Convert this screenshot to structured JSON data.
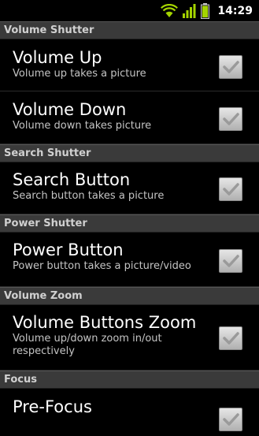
{
  "status_bar": {
    "time": "14:29",
    "icons": [
      "wifi-icon",
      "signal-icon",
      "battery-icon"
    ],
    "accent": "#a4d400"
  },
  "categories": [
    {
      "title": "Volume Shutter",
      "items": [
        {
          "title": "Volume Up",
          "summary": "Volume up takes a picture",
          "checked": true
        },
        {
          "title": "Volume Down",
          "summary": "Volume down takes picture",
          "checked": true
        }
      ]
    },
    {
      "title": "Search Shutter",
      "items": [
        {
          "title": "Search Button",
          "summary": "Search button takes a picture",
          "checked": true
        }
      ]
    },
    {
      "title": "Power Shutter",
      "items": [
        {
          "title": "Power Button",
          "summary": "Power button takes a picture/video",
          "checked": true
        }
      ]
    },
    {
      "title": "Volume Zoom",
      "items": [
        {
          "title": "Volume Buttons Zoom",
          "summary": "Volume up/down zoom in/out respectively",
          "checked": true
        }
      ]
    },
    {
      "title": "Focus",
      "items": [
        {
          "title": "Pre-Focus",
          "summary": "",
          "checked": true
        }
      ]
    }
  ]
}
